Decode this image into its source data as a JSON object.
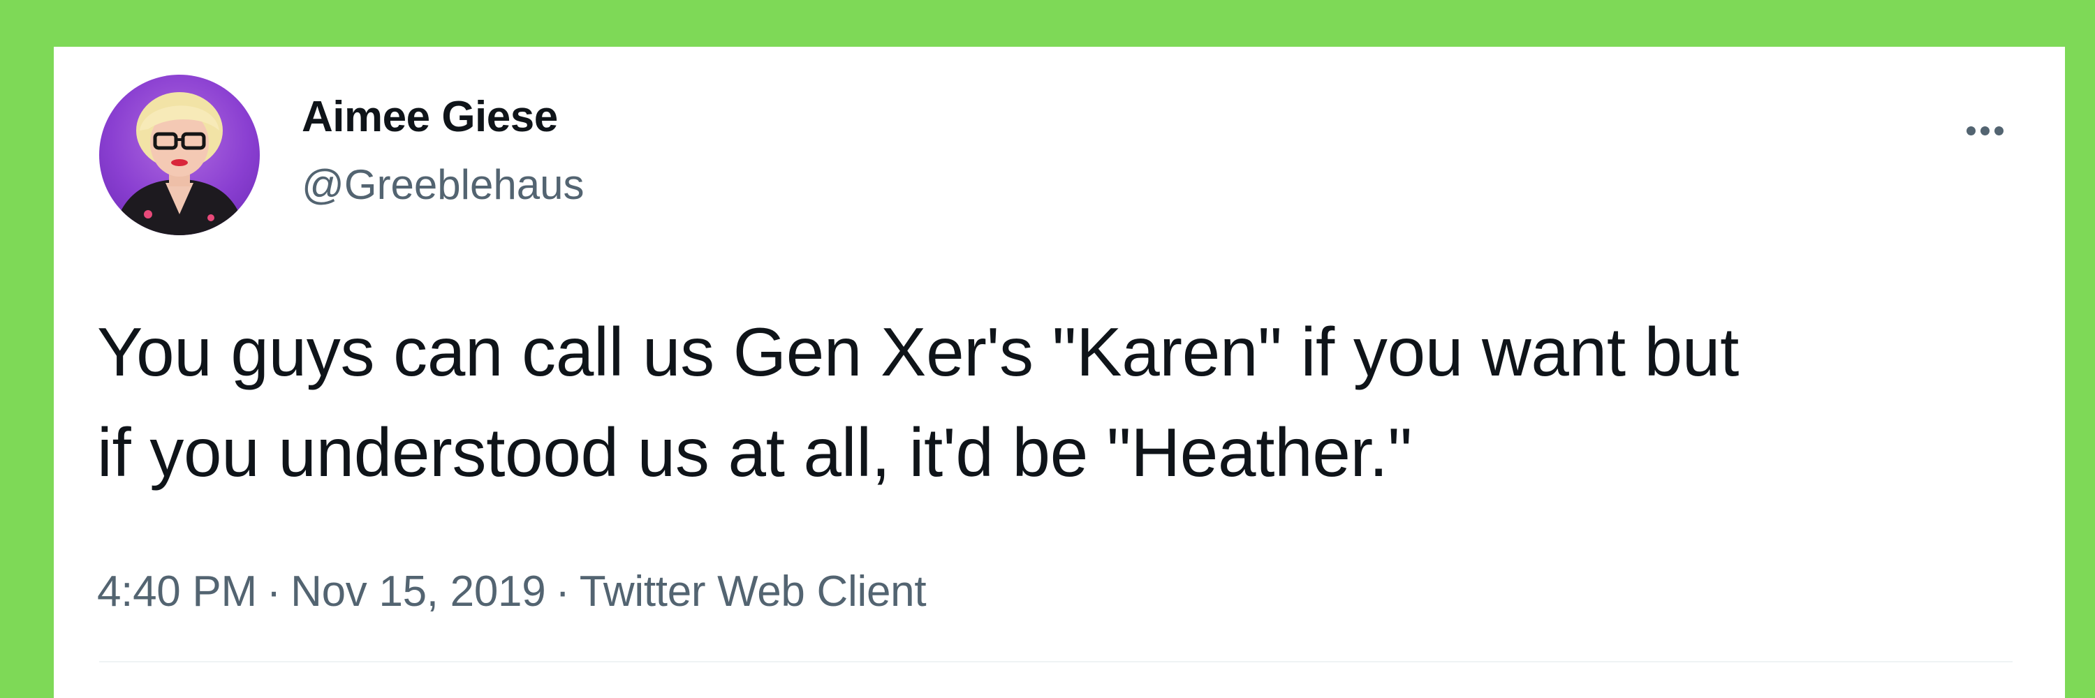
{
  "tweet": {
    "author_name": "Aimee Giese",
    "author_handle": "@Greeblehaus",
    "text_line1": "You guys can call us Gen Xer's \"Karen\" if you want but",
    "text_line2": "if you understood us at all, it'd be \"Heather.\"",
    "time": "4:40 PM",
    "separator": "·",
    "date": "Nov 15, 2019",
    "source": "Twitter Web Client",
    "avatar_icon": "profile-photo",
    "more_icon": "more-options-icon"
  },
  "colors": {
    "background": "#7ed957",
    "card": "#ffffff",
    "text_primary": "#0f1419",
    "text_secondary": "#536471",
    "avatar_bg": "#8a3fd1"
  }
}
